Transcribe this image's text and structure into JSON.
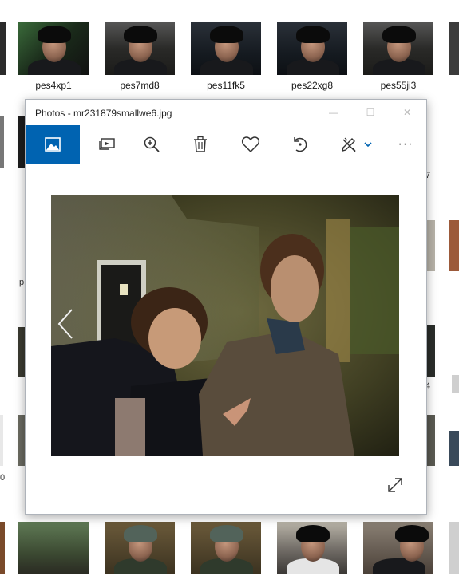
{
  "explorer": {
    "thumbnails_top": [
      {
        "label": "pes4xp1"
      },
      {
        "label": "pes7md8"
      },
      {
        "label": "pes11fk5"
      },
      {
        "label": "pes22xg8"
      },
      {
        "label": "pes55ji3"
      }
    ],
    "edge_fragments": [
      "p",
      "0",
      "4",
      "7"
    ]
  },
  "photos_window": {
    "title": "Photos - mr231879smallwe6.jpg",
    "controls": {
      "minimize": "—",
      "maximize": "☐",
      "close": "✕"
    },
    "toolbar": {
      "items": [
        {
          "name": "view-photo",
          "icon": "image-icon",
          "active": true
        },
        {
          "name": "slideshow",
          "icon": "slideshow-icon"
        },
        {
          "name": "zoom",
          "icon": "zoom-icon"
        },
        {
          "name": "delete",
          "icon": "trash-icon"
        },
        {
          "name": "favorite",
          "icon": "heart-icon"
        },
        {
          "name": "rotate",
          "icon": "rotate-icon"
        },
        {
          "name": "edit-create",
          "icon": "edit-pencil-icon"
        },
        {
          "name": "more",
          "icon": "more-icon"
        }
      ],
      "more_label": "···"
    },
    "accent_color": "#0063b1"
  }
}
